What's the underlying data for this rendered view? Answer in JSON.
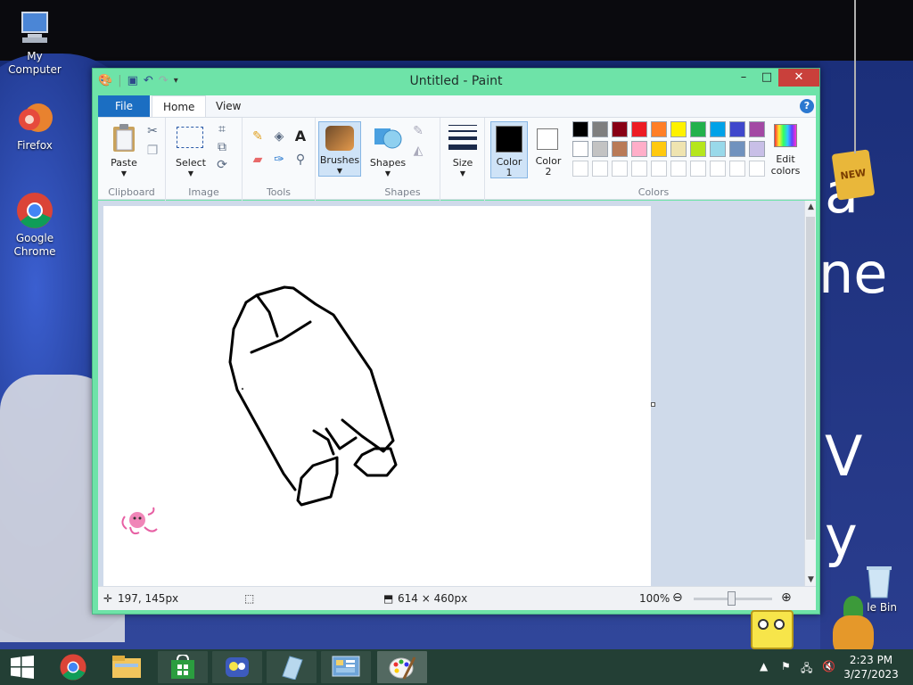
{
  "desktop": {
    "icons": [
      {
        "label": "My Computer"
      },
      {
        "label": "Firefox"
      },
      {
        "label": "Google Chrome"
      },
      {
        "label": "le Bin"
      }
    ],
    "wall_text": {
      "a": "a",
      "ne": "ne",
      "v": "V",
      "y": "y"
    },
    "badge": "NEW"
  },
  "window": {
    "title": "Untitled - Paint",
    "menu": {
      "file": "File",
      "home": "Home",
      "view": "View",
      "help": "?"
    },
    "ribbon": {
      "clipboard": {
        "label": "Clipboard",
        "paste": "Paste"
      },
      "image": {
        "label": "Image",
        "select": "Select"
      },
      "tools": {
        "label": "Tools"
      },
      "brushes": "Brushes",
      "shapes": {
        "label": "Shapes",
        "button": "Shapes"
      },
      "size": "Size",
      "color1": {
        "l1": "Color",
        "l2": "1"
      },
      "color2": {
        "l1": "Color",
        "l2": "2"
      },
      "colors": {
        "label": "Colors",
        "edit_l1": "Edit",
        "edit_l2": "colors"
      }
    },
    "palette": {
      "row1": [
        "#000000",
        "#7f7f7f",
        "#880015",
        "#ed1c24",
        "#ff7f27",
        "#fff200",
        "#22b14c",
        "#00a2e8",
        "#3f48cc",
        "#a349a4"
      ],
      "row2": [
        "#ffffff",
        "#c3c3c3",
        "#b97a57",
        "#ffaec9",
        "#ffc90e",
        "#efe4b0",
        "#b5e61d",
        "#99d9ea",
        "#7092be",
        "#c8bfe7"
      ],
      "row3": [
        "#ffffff",
        "#ffffff",
        "#ffffff",
        "#ffffff",
        "#ffffff",
        "#ffffff",
        "#ffffff",
        "#ffffff",
        "#ffffff",
        "#ffffff"
      ]
    },
    "status": {
      "cursor_pos": "197, 145px",
      "canvas_size": "614 × 460px",
      "zoom": "100%"
    }
  },
  "taskbar": {
    "time": "2:23 PM",
    "date": "3/27/2023"
  }
}
